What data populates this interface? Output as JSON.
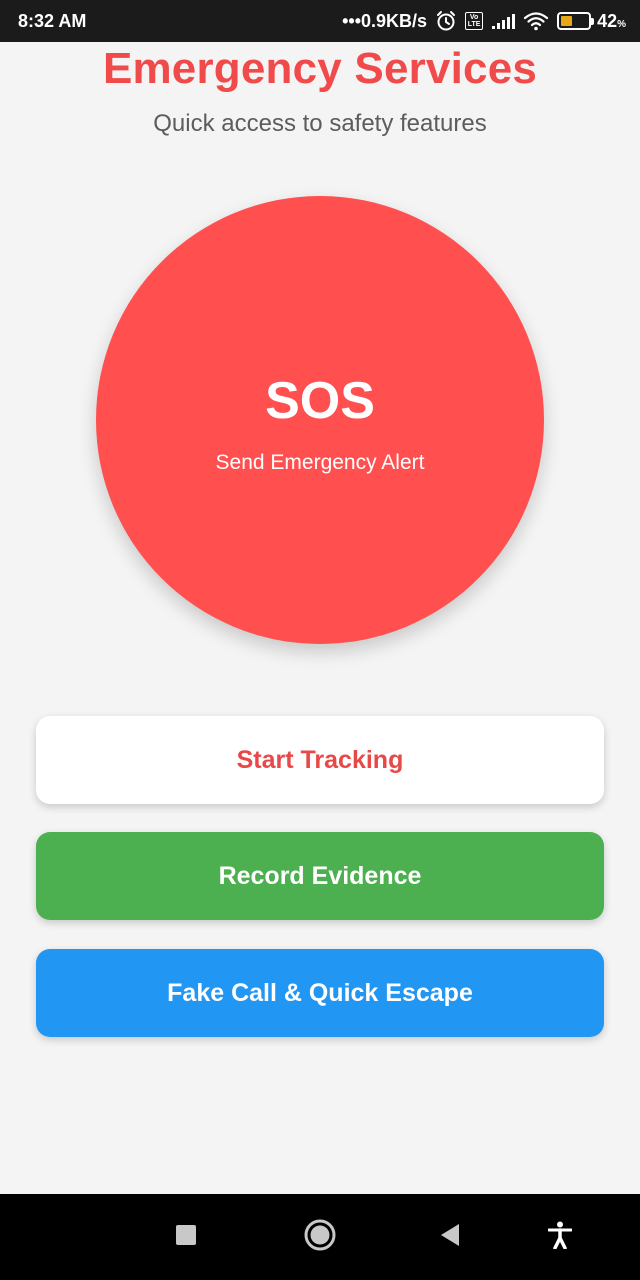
{
  "status_bar": {
    "time": "8:32 AM",
    "network_speed": "•••0.9KB/s",
    "icons": [
      "alarm-icon",
      "volte-icon",
      "signal-icon",
      "wifi-icon",
      "battery-icon"
    ],
    "volte_text": "Vo LTE",
    "battery_percent": "42",
    "battery_unit": "%",
    "battery_level": 0.42,
    "battery_color": "#e6a817"
  },
  "header": {
    "title": "Emergency Services",
    "subtitle": "Quick access to safety features",
    "title_color": "#f04a4a"
  },
  "sos": {
    "label": "SOS",
    "sublabel": "Send Emergency Alert",
    "color": "#ff4f4f"
  },
  "actions": [
    {
      "label": "Start Tracking",
      "bg": "#ffffff",
      "text_color": "#e84848"
    },
    {
      "label": "Record Evidence",
      "bg": "#4caf50",
      "text_color": "#ffffff"
    },
    {
      "label": "Fake Call & Quick Escape",
      "bg": "#2196f3",
      "text_color": "#ffffff"
    }
  ],
  "nav_bar": {
    "icons": [
      "recents-square-icon",
      "home-circle-icon",
      "back-triangle-icon",
      "accessibility-icon"
    ]
  }
}
